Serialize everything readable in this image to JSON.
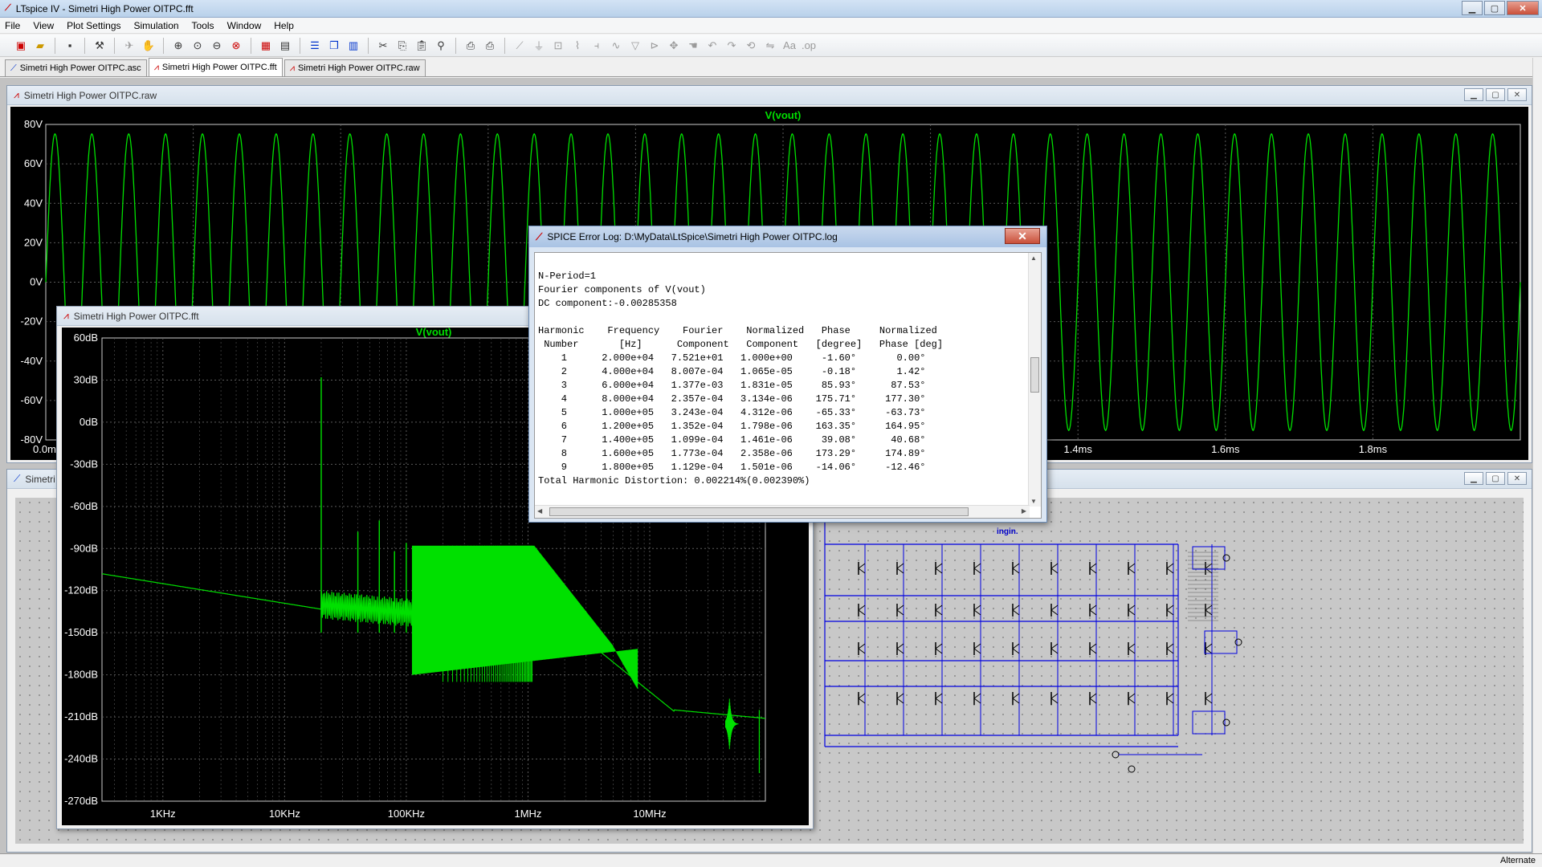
{
  "app": {
    "title": "LTspice IV - Simetri High Power OITPC.fft"
  },
  "menu": [
    "File",
    "View",
    "Plot Settings",
    "Simulation",
    "Tools",
    "Window",
    "Help"
  ],
  "tabs": [
    {
      "label": "Simetri High Power OITPC.asc"
    },
    {
      "label": "Simetri High Power OITPC.fft"
    },
    {
      "label": "Simetri High Power OITPC.raw"
    }
  ],
  "raw_window": {
    "title": "Simetri High Power OITPC.raw",
    "trace": "V(vout)",
    "y_ticks": [
      "80V",
      "60V",
      "40V",
      "20V",
      "0V",
      "-20V",
      "-40V",
      "-60V",
      "-80V"
    ],
    "x_ticks": [
      "0.0ms",
      "1.4ms",
      "1.6ms",
      "1.8ms"
    ]
  },
  "fft_window": {
    "title": "Simetri High Power OITPC.fft",
    "trace": "V(vout)",
    "y_ticks": [
      "60dB",
      "30dB",
      "0dB",
      "-30dB",
      "-60dB",
      "-90dB",
      "-120dB",
      "-150dB",
      "-180dB",
      "-210dB",
      "-240dB",
      "-270dB"
    ],
    "x_ticks": [
      "1KHz",
      "10KHz",
      "100KHz",
      "1MHz",
      "10MHz"
    ]
  },
  "schematic_window": {
    "title": "Simetri",
    "note": "ingin."
  },
  "log_window": {
    "title": "SPICE Error Log: D:\\MyData\\LtSpice\\Simetri High Power OITPC.log",
    "lines": [
      "",
      "N-Period=1",
      "Fourier components of V(vout)",
      "DC component:-0.00285358",
      "",
      "Harmonic    Frequency    Fourier    Normalized   Phase     Normalized",
      " Number       [Hz]      Component   Component   [degree]   Phase [deg]",
      "    1      2.000e+04   7.521e+01   1.000e+00     -1.60°       0.00°",
      "    2      4.000e+04   8.007e-04   1.065e-05     -0.18°       1.42°",
      "    3      6.000e+04   1.377e-03   1.831e-05     85.93°      87.53°",
      "    4      8.000e+04   2.357e-04   3.134e-06    175.71°     177.30°",
      "    5      1.000e+05   3.243e-04   4.312e-06    -65.33°     -63.73°",
      "    6      1.200e+05   1.352e-04   1.798e-06    163.35°     164.95°",
      "    7      1.400e+05   1.099e-04   1.461e-06     39.08°      40.68°",
      "    8      1.600e+05   1.773e-04   2.358e-06    173.29°     174.89°",
      "    9      1.800e+05   1.129e-04   1.501e-06    -14.06°     -12.46°",
      "Total Harmonic Distortion: 0.002214%(0.002390%)"
    ]
  },
  "status": {
    "right": "Alternate"
  },
  "colors": {
    "trace": "#00e000",
    "grid": "#5a5a5a",
    "wire": "#0000e0"
  }
}
